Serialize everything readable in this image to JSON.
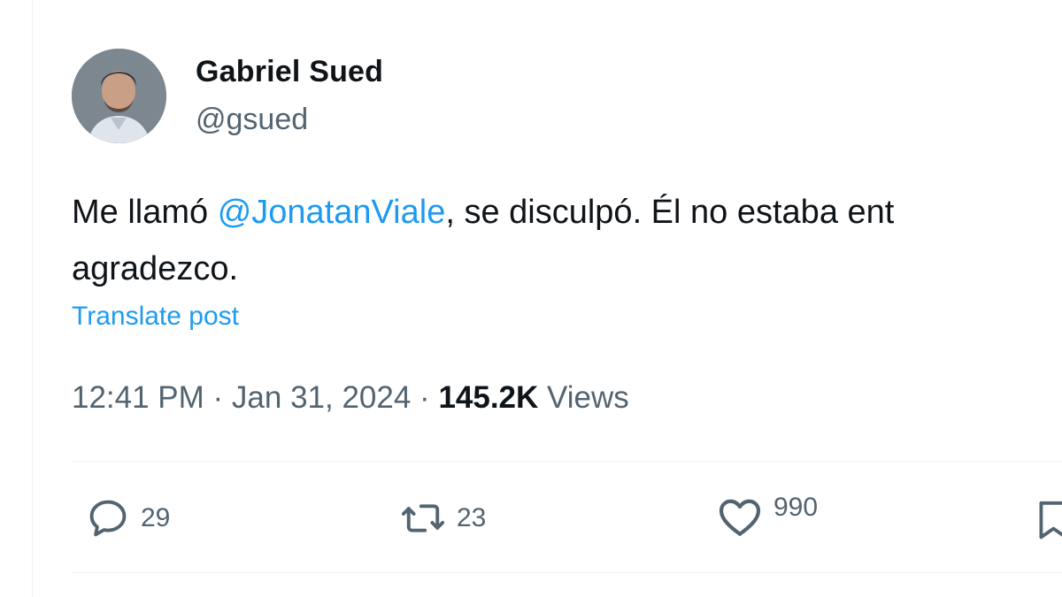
{
  "author": {
    "name": "Gabriel Sued",
    "handle": "@gsued"
  },
  "post": {
    "text_before": "Me llamó ",
    "mention": "@JonatanViale",
    "text_after": ", se disculpó. Él no estaba ent",
    "text_line2": "agradezco.",
    "translate_label": "Translate post"
  },
  "meta": {
    "time": "12:41 PM",
    "separator": " · ",
    "date": "Jan 31, 2024",
    "views_count": "145.2K",
    "views_label": " Views"
  },
  "actions": {
    "replies": "29",
    "reposts": "23",
    "likes": "990"
  },
  "colors": {
    "accent": "#1d9bf0",
    "text": "#0f1419",
    "secondary": "#536471",
    "border": "#eff3f4"
  },
  "icons": {
    "reply": "reply-icon",
    "repost": "repost-icon",
    "like": "heart-icon",
    "bookmark": "bookmark-icon"
  }
}
